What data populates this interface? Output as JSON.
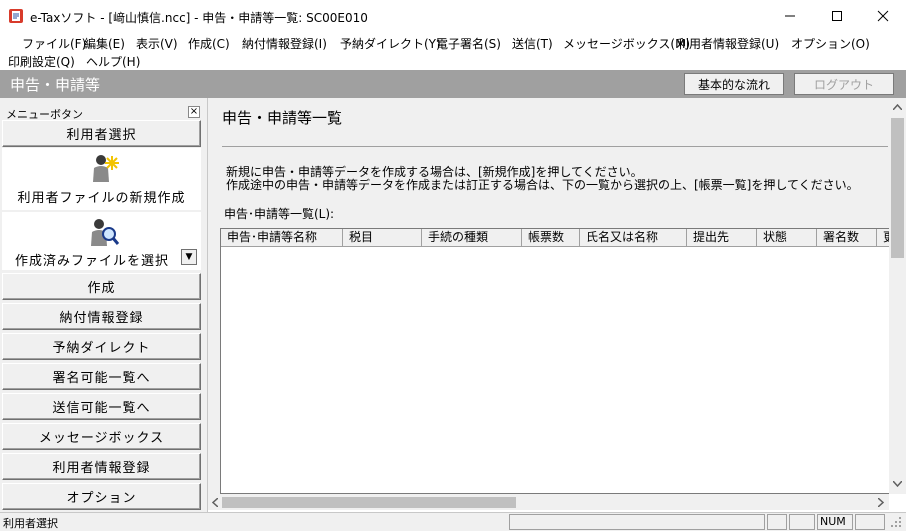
{
  "window": {
    "title": "e-Taxソフト - [﨑山慎信.ncc] - 申告・申請等一覧: SC00E010",
    "minimize": "—",
    "maximize": "☐",
    "close": "✕"
  },
  "menubar": {
    "items": [
      "ファイル(F)",
      "編集(E)",
      "表示(V)",
      "作成(C)",
      "納付情報登録(I)",
      "予納ダイレクト(Y)",
      "電子署名(S)",
      "送信(T)",
      "メッセージボックス(M)",
      "利用者情報登録(U)",
      "オプション(O)",
      "印刷設定(Q)",
      "ヘルプ(H)"
    ]
  },
  "header": {
    "title": "申告・申請等",
    "flow_button": "基本的な流れ",
    "logout_button": "ログアウト"
  },
  "left_panel": {
    "menu_label": "メニューボタン",
    "close_glyph": "×",
    "user_select": "利用者選択",
    "new_file": "利用者ファイルの新規作成",
    "open_file": "作成済みファイルを選択",
    "dropdown_glyph": "▼",
    "buttons": [
      "作成",
      "納付情報登録",
      "予納ダイレクト",
      "署名可能一覧へ",
      "送信可能一覧へ",
      "メッセージボックス",
      "利用者情報登録",
      "オプション"
    ]
  },
  "main": {
    "title": "申告・申請等一覧",
    "desc_line1": "新規に申告・申請等データを作成する場合は、[新規作成]を押してください。",
    "desc_line2": "作成途中の申告・申請等データを作成または訂正する場合は、下の一覧から選択の上、[帳票一覧]を押してください。",
    "list_label": "申告･申請等一覧(L):",
    "columns": [
      "申告･申請等名称",
      "税目",
      "手続の種類",
      "帳票数",
      "氏名又は名称",
      "提出先",
      "状態",
      "署名数",
      "更"
    ]
  },
  "status": {
    "text": "利用者選択",
    "num": "NUM"
  },
  "colors": {
    "header_band": "#a0a0a0",
    "panel_bg": "#f0f0f0"
  }
}
